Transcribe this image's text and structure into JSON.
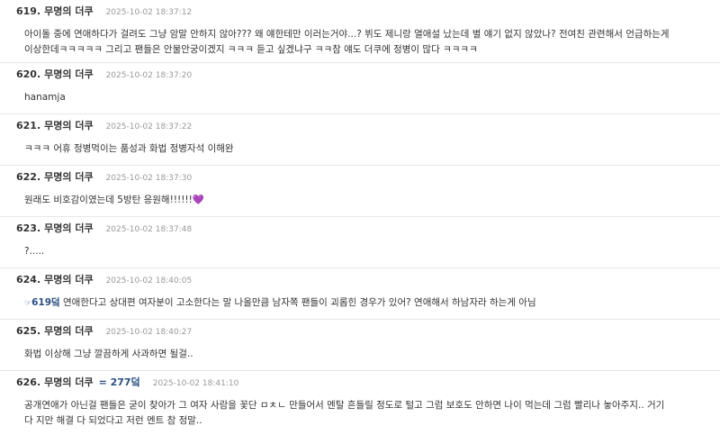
{
  "posts": [
    {
      "num": "619.",
      "author": "무명의 더쿠",
      "time": "2025-10-02 18:37:12",
      "line1": "아이돌 중에 연애하다가 걸려도 그냥 암말 안하지 않아??? 왜 얘한테만 이러는거야...? 뷔도 제니랑 열애설 났는데 별 얘기 없지 않았나? 전여친 관련해서 언급하는게",
      "line2": "이상한데ㅋㅋㅋㅋㅋ 그리고 팬들은 안물안궁이겠지 ㅋㅋㅋ 듣고 싶겠냐구 ㅋㅋ참 얘도 더쿠에 정병이 많다 ㅋㅋㅋㅋ"
    },
    {
      "num": "620.",
      "author": "무명의 더쿠",
      "time": "2025-10-02 18:37:20",
      "line1": "hanamja"
    },
    {
      "num": "621.",
      "author": "무명의 더쿠",
      "time": "2025-10-02 18:37:22",
      "line1": "ㅋㅋㅋ 어휴 정병먹이는 품성과 화법 정병자석 이해완"
    },
    {
      "num": "622.",
      "author": "무명의 더쿠",
      "time": "2025-10-02 18:37:30",
      "line1": "원래도 비호감이였는데 5방탄 응원해!!!!!!",
      "heart": "💜"
    },
    {
      "num": "623.",
      "author": "무명의 더쿠",
      "time": "2025-10-02 18:37:48",
      "line1": "?....."
    },
    {
      "num": "624.",
      "author": "무명의 더쿠",
      "time": "2025-10-02 18:40:05",
      "anchor": "619덬",
      "anchor_icon": "☞",
      "line1": " 연애한다고 상대편 여자분이 고소한다는 말 나올만큼 남자쪽 팬들이 괴롭힌 경우가 있어? 연애해서 하남자라 하는게 아님"
    },
    {
      "num": "625.",
      "author": "무명의 더쿠",
      "time": "2025-10-02 18:40:27",
      "line1": "화법 이상해 그냥 깔끔하게 사과하면 될걸.."
    },
    {
      "num": "626.",
      "author": "무명의 더쿠",
      "reply": "= 277덬",
      "time": "2025-10-02 18:41:10",
      "line1": "공개연애가 아닌걸 팬들은 굳이 찾아가 그 여자 사람을 꽃단 ㅁㅊㄴ 만들어서 멘탈 흔들릴 정도로 털고 그럼 보호도 안하면 나이 먹는데 그럼 빨리나 놓아주지.. 거기",
      "line2": "다 지만 해결 다 되었다고 저런 멘트 참 정말.."
    }
  ]
}
